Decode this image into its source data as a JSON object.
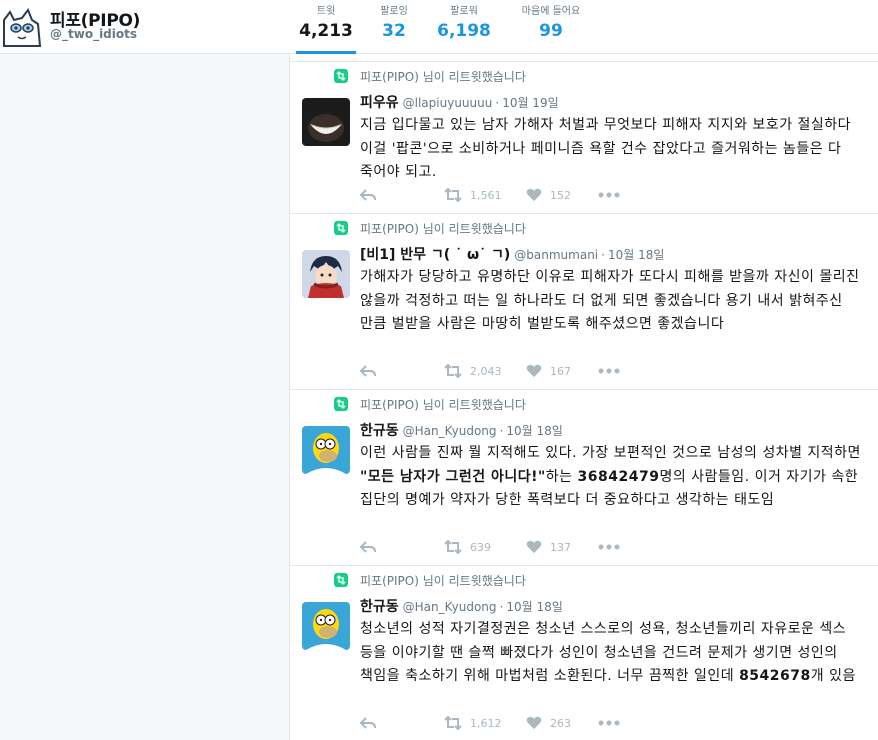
{
  "profile": {
    "name": "피포(PIPO)",
    "handle": "@_two_idiots"
  },
  "stats": [
    {
      "id": "stat-tweets",
      "label": "트윗",
      "value": "4,213",
      "active": true
    },
    {
      "id": "stat-following",
      "label": "팔로잉",
      "value": "32",
      "active": false
    },
    {
      "id": "stat-followers",
      "label": "팔로워",
      "value": "6,198",
      "active": false
    },
    {
      "id": "stat-likes",
      "label": "마음에 들어요",
      "value": "99",
      "active": false
    }
  ],
  "colors": {
    "accent": "#1b95e0",
    "retweet_green": "#19cf86",
    "muted": "#657786",
    "icon_gray": "#aab8c2"
  },
  "tweets": [
    {
      "retweet_label": "피포(PIPO) 님이 리트윗했습니다",
      "name": "피우유",
      "handle": "@llapiuyuuuuu",
      "time": "10월 19일",
      "avatar_icon": "grin-face-avatar",
      "body_html": "지금 입다물고 있는 남자 가해자 처벌과 무엇보다 피해자 지지와 보호가 절실하다 이걸 '팝콘'으로 소비하거나 페미니즘 욕할 건수 잡았다고 즐거워하는 놈들은 다 죽어야 되고.",
      "retweets": "1,561",
      "likes": "152"
    },
    {
      "retweet_label": "피포(PIPO) 님이 리트윗했습니다",
      "name": "[비1] 반무 ㄱ( ˙ ω˙ ㄱ)",
      "handle": "@banmumani",
      "time": "10월 18일",
      "avatar_icon": "anime-character-avatar",
      "body_html": "가해자가 당당하고 유명하단 이유로 피해자가 또다시 피해를 받을까 자신이 몰리진 않을까 걱정하고 떠는 일 하나라도 더 없게 되면 좋겠습니다 용기 내서 밝혀주신 만큼 벌받을 사람은 마땅히 벌받도록 해주셨으면 좋겠습니다",
      "retweets": "2,043",
      "likes": "167"
    },
    {
      "retweet_label": "피포(PIPO) 님이 리트윗했습니다",
      "name": "한규동",
      "handle": "@Han_Kyudong",
      "time": "10월 18일",
      "avatar_icon": "homer-simpson-avatar",
      "body_html": "이런 사람들 진짜 뭘 지적해도 있다. 가장 보편적인 것으로 남성의 성차별 지적하면 <b>\"모든 남자가 그런건 아니다!\"</b>하는 <b>36842479</b>명의 사람들임. 이거 자기가 속한 집단의 명예가 약자가 당한 폭력보다 더 중요하다고 생각하는 태도임",
      "retweets": "639",
      "likes": "137"
    },
    {
      "retweet_label": "피포(PIPO) 님이 리트윗했습니다",
      "name": "한규동",
      "handle": "@Han_Kyudong",
      "time": "10월 18일",
      "avatar_icon": "homer-simpson-avatar",
      "body_html": "청소년의 성적 자기결정권은 청소년 스스로의 성욕, 청소년들끼리 자유로운 섹스 등을 이야기할 땐 슬쩍 빠졌다가 성인이 청소년을 건드려 문제가 생기면 성인의 책임을 축소하기 위해 마법처럼 소환된다. 너무 끔찍한 일인데 <b>8542678</b>개 있음",
      "retweets": "1,612",
      "likes": "263"
    }
  ]
}
